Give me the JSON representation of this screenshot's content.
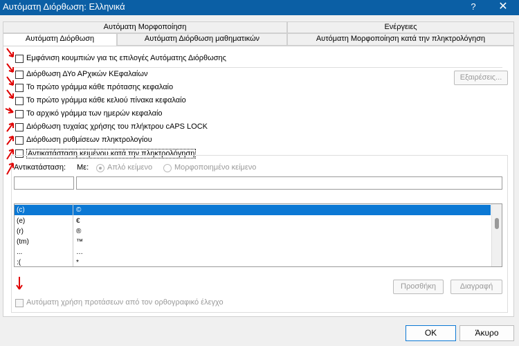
{
  "window": {
    "title": "Αυτόματη Διόρθωση: Ελληνικά",
    "help": "?",
    "close": "✕"
  },
  "tabs_top": [
    "Αυτόματη Μορφοποίηση",
    "Ενέργειες"
  ],
  "tabs_bottom": [
    "Αυτόματη Διόρθωση",
    "Αυτόματη Διόρθωση μαθηματικών",
    "Αυτόματη Μορφοποίηση κατά την πληκτρολόγηση"
  ],
  "options": {
    "show_buttons": "Εμφάνιση κουμπιών για τις επιλογές Αυτόματης Διόρθωσης",
    "two_initials": "Διόρθωση ΔΥο ΑΡχικών ΚΕφαλαίων",
    "first_letter_sentence": "Το πρώτο γράμμα κάθε πρότασης κεφαλαίο",
    "first_letter_cell": "Το πρώτο γράμμα κάθε κελιού πίνακα κεφαλαίο",
    "day_names": "Το αρχικό γράμμα των ημερών κεφαλαίο",
    "caps_lock": "Διόρθωση τυχαίας χρήσης του πλήκτρου cAPS LOCK",
    "keyboard_settings": "Διόρθωση ρυθμίσεων πληκτρολογίου",
    "replace_text": "Αντικατάσταση κειμένου κατά την πληκτρολόγηση"
  },
  "exceptions_button": "Εξαιρέσεις...",
  "replace": {
    "label": "Αντικατάσταση:",
    "with_label": "Με:",
    "plain_text": "Απλό κείμενο",
    "formatted_text": "Μορφοποιημένο κείμενο",
    "replace_value": "",
    "with_value": ""
  },
  "entries": [
    {
      "from": "(c)",
      "to": "©"
    },
    {
      "from": "(e)",
      "to": "€"
    },
    {
      "from": "(r)",
      "to": "®"
    },
    {
      "from": "(tm)",
      "to": "™"
    },
    {
      "from": "...",
      "to": "…"
    },
    {
      "from": ":(",
      "to": "*"
    }
  ],
  "add_button": "Προσθήκη",
  "delete_button": "Διαγραφή",
  "spelling_suggestions": "Αυτόματη χρήση προτάσεων από τον ορθογραφικό έλεγχο",
  "ok_button": "OK",
  "cancel_button": "Άκυρο",
  "colors": {
    "titlebar": "#0b5fa5",
    "selection": "#0b78d4",
    "annotation_arrow": "#e00000"
  }
}
